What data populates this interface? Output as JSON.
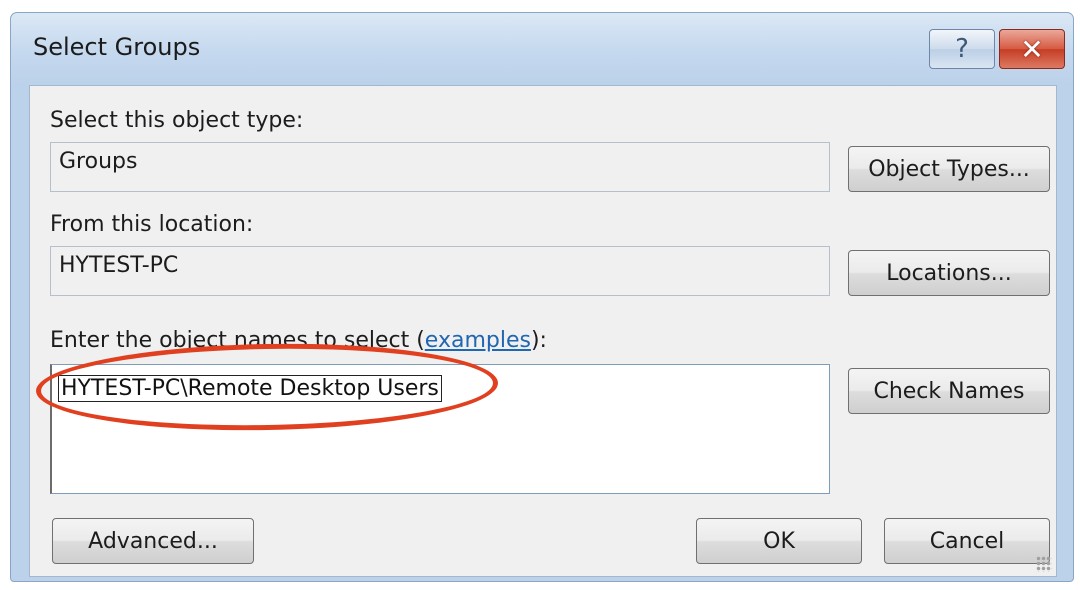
{
  "window": {
    "title": "Select Groups",
    "help_glyph": "?",
    "close_glyph": "✕"
  },
  "object_type": {
    "label": "Select this object type:",
    "value": "Groups",
    "button": "Object Types..."
  },
  "location": {
    "label": "From this location:",
    "value": "HYTEST-PC",
    "button": "Locations..."
  },
  "names": {
    "label_prefix": "Enter the object names to select (",
    "label_link": "examples",
    "label_suffix": "):",
    "value": "HYTEST-PC\\Remote Desktop Users",
    "button": "Check Names"
  },
  "footer": {
    "advanced": "Advanced...",
    "ok": "OK",
    "cancel": "Cancel"
  },
  "colors": {
    "annotation_ellipse": "#e0401f",
    "link": "#2066b0"
  }
}
